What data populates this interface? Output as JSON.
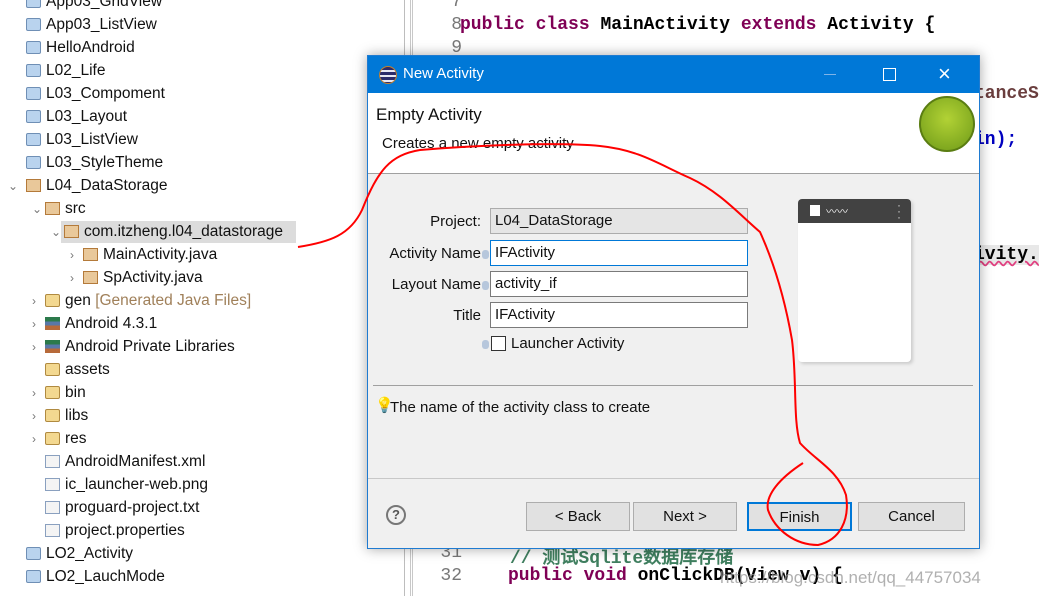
{
  "tree": {
    "items": [
      {
        "label": "App03_GridView",
        "icon": "project-folder-icon"
      },
      {
        "label": "App03_ListView",
        "icon": "project-folder-icon"
      },
      {
        "label": "HelloAndroid",
        "icon": "project-folder-icon"
      },
      {
        "label": "L02_Life",
        "icon": "project-folder-icon"
      },
      {
        "label": "L03_Compoment",
        "icon": "project-folder-icon"
      },
      {
        "label": "L03_Layout",
        "icon": "project-folder-icon"
      },
      {
        "label": "L03_ListView",
        "icon": "project-folder-icon"
      },
      {
        "label": "L03_StyleTheme",
        "icon": "project-folder-icon"
      },
      {
        "label": "L04_DataStorage",
        "icon": "android-project-error-icon"
      },
      {
        "label": "src",
        "icon": "source-folder-error-icon"
      },
      {
        "label": "com.itzheng.l04_datastorage",
        "icon": "package-error-icon",
        "selected": true
      },
      {
        "label": "MainActivity.java",
        "icon": "java-file-error-icon"
      },
      {
        "label": "SpActivity.java",
        "icon": "java-file-warning-icon"
      },
      {
        "label": "gen",
        "suffix": "[Generated Java Files]",
        "icon": "gen-folder-icon"
      },
      {
        "label": "Android 4.3.1",
        "icon": "library-icon"
      },
      {
        "label": "Android Private Libraries",
        "icon": "library-icon"
      },
      {
        "label": "assets",
        "icon": "folder-icon"
      },
      {
        "label": "bin",
        "icon": "folder-icon"
      },
      {
        "label": "libs",
        "icon": "folder-icon"
      },
      {
        "label": "res",
        "icon": "folder-warning-icon"
      },
      {
        "label": "AndroidManifest.xml",
        "icon": "manifest-icon"
      },
      {
        "label": "ic_launcher-web.png",
        "icon": "file-icon"
      },
      {
        "label": "proguard-project.txt",
        "icon": "file-icon"
      },
      {
        "label": "project.properties",
        "icon": "file-icon"
      },
      {
        "label": "LO2_Activity",
        "icon": "project-folder-icon"
      },
      {
        "label": "LO2_LauchMode",
        "icon": "project-folder-icon"
      }
    ]
  },
  "editor": {
    "lines": [
      {
        "n": "7",
        "code": ""
      },
      {
        "n": "8",
        "kw1": "public class ",
        "name": "MainActivity ",
        "kw2": "extends ",
        "rest": "Activity {"
      },
      {
        "n": "9",
        "code": ""
      },
      {
        "n": "31",
        "comment": "// 测试Sqlite数据库存储"
      },
      {
        "n": "32",
        "kw1": "public void ",
        "rest": "onClickDB(View v) {"
      }
    ],
    "fragments": [
      "tanceS",
      "in);",
      "ivity."
    ],
    "watermark": "https://blog.csdn.net/qq_44757034"
  },
  "dialog": {
    "title": "New Activity",
    "heading": "Empty Activity",
    "description": "Creates a new empty activity",
    "fields": {
      "project_label": "Project:",
      "project_value": "L04_DataStorage",
      "activity_label": "Activity Name",
      "activity_value": "IFActivity",
      "layout_label": "Layout Name",
      "layout_value": "activity_if",
      "title_label": "Title",
      "title_value": "IFActivity",
      "launcher_label": "Launcher Activity",
      "launcher_checked": false
    },
    "hint": "The name of the activity class to create",
    "buttons": {
      "back": "< Back",
      "next": "Next >",
      "finish": "Finish",
      "cancel": "Cancel"
    },
    "accent": "#0078d7"
  },
  "annotation_color": "#ff0000"
}
